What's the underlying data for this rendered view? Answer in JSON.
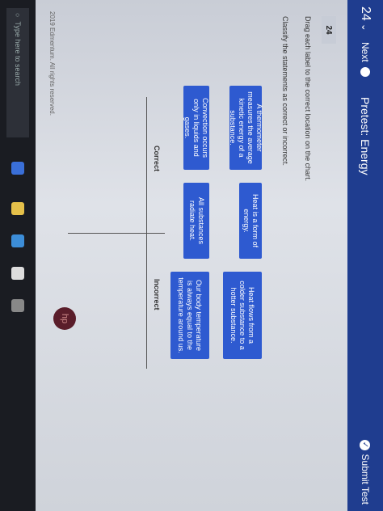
{
  "topbar": {
    "question_number": "24",
    "question_chevron": "⌄",
    "next_label": "Next",
    "title": "Pretest: Energy",
    "submit_label": "Submit Test"
  },
  "question": {
    "badge": "24",
    "instruction": "Drag each label to the correct location on the chart.",
    "prompt": "Classify the statements as correct or incorrect."
  },
  "labels": [
    "A thermometer measures the average kinetic energy of a substance.",
    "Heat is a form of energy.",
    "Heat flows from a colder substance to a hotter substance.",
    "Convection occurs only in liquids and gases.",
    "All substances radiate heat.",
    "Our body temperature is always equal to the temperature around us."
  ],
  "chart": {
    "headers": [
      "Correct",
      "Incorrect"
    ]
  },
  "footer": {
    "copyright": "2019 Edmentum. All rights reserved."
  },
  "taskbar": {
    "search_placeholder": "Type here to search",
    "hp_logo_text": "hp"
  },
  "colors": {
    "topbar": "#1f3d8f",
    "tile": "#2e5ad0"
  }
}
